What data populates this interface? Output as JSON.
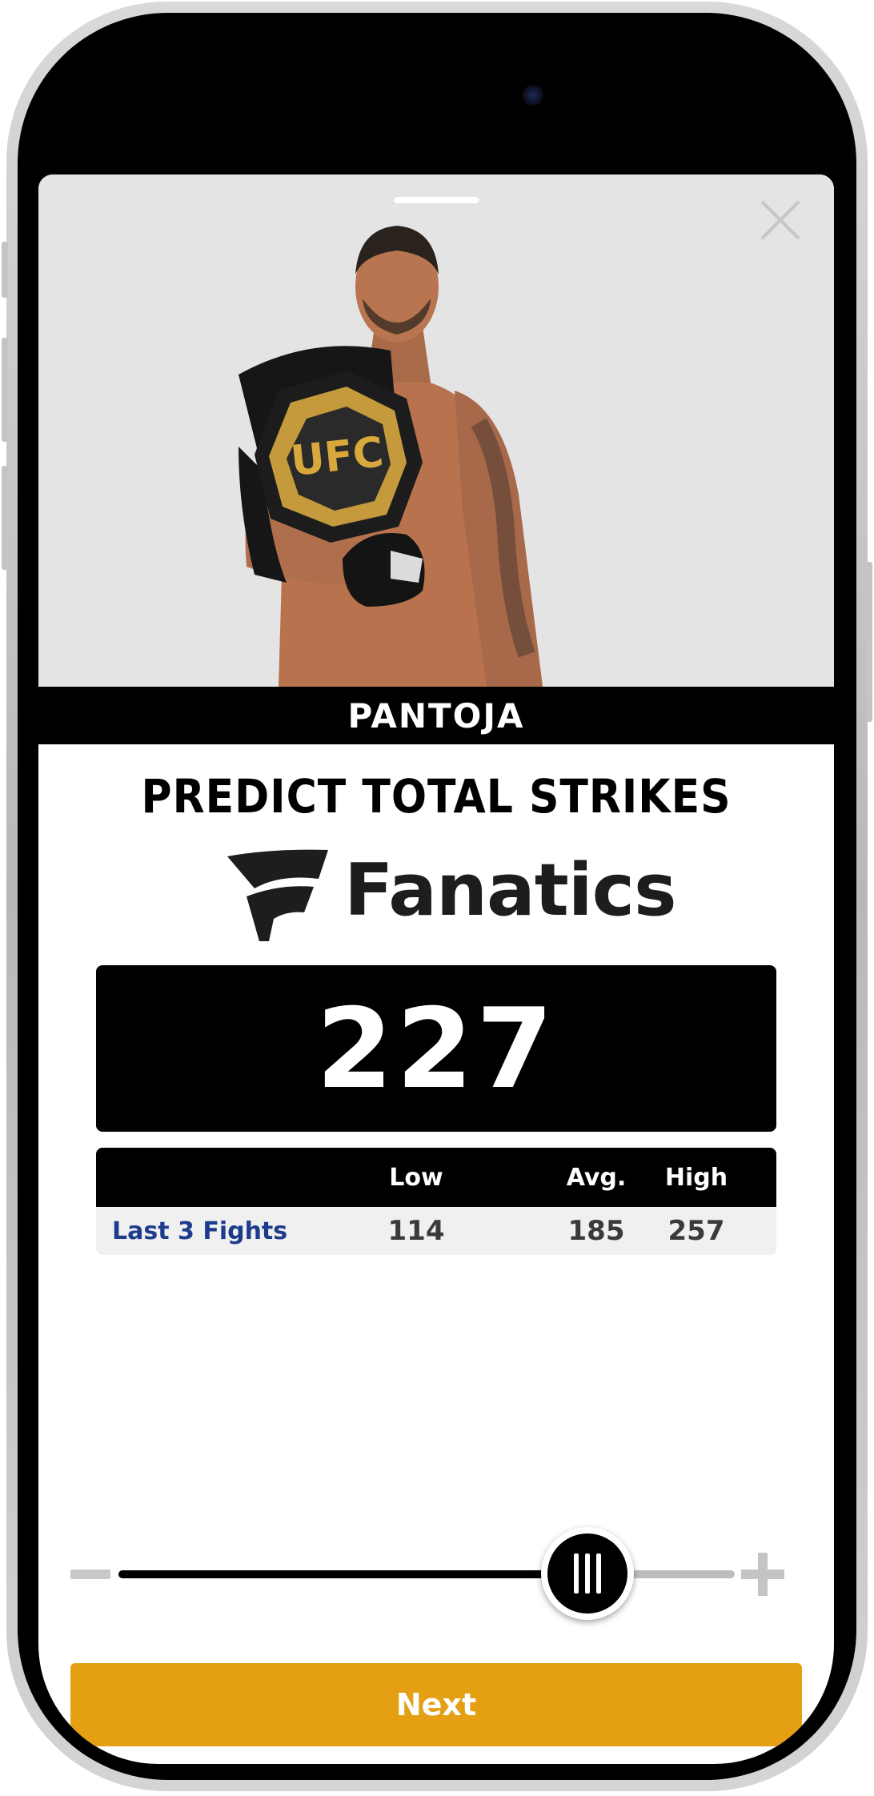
{
  "fighter": {
    "name": "PANTOJA"
  },
  "prompt": {
    "title": "PREDICT TOTAL STRIKES"
  },
  "sponsor": {
    "name": "Fanatics"
  },
  "prediction": {
    "value": "227"
  },
  "stats": {
    "columns": [
      "Low",
      "Avg.",
      "High"
    ],
    "rows": [
      {
        "label": "Last 3 Fights",
        "low": "114",
        "avg": "185",
        "high": "257"
      }
    ]
  },
  "slider": {
    "value": 227,
    "min": 0,
    "max": 300
  },
  "actions": {
    "next_label": "Next"
  },
  "colors": {
    "accent": "#e49f13",
    "link": "#1e3c8c",
    "background": "#000000"
  }
}
